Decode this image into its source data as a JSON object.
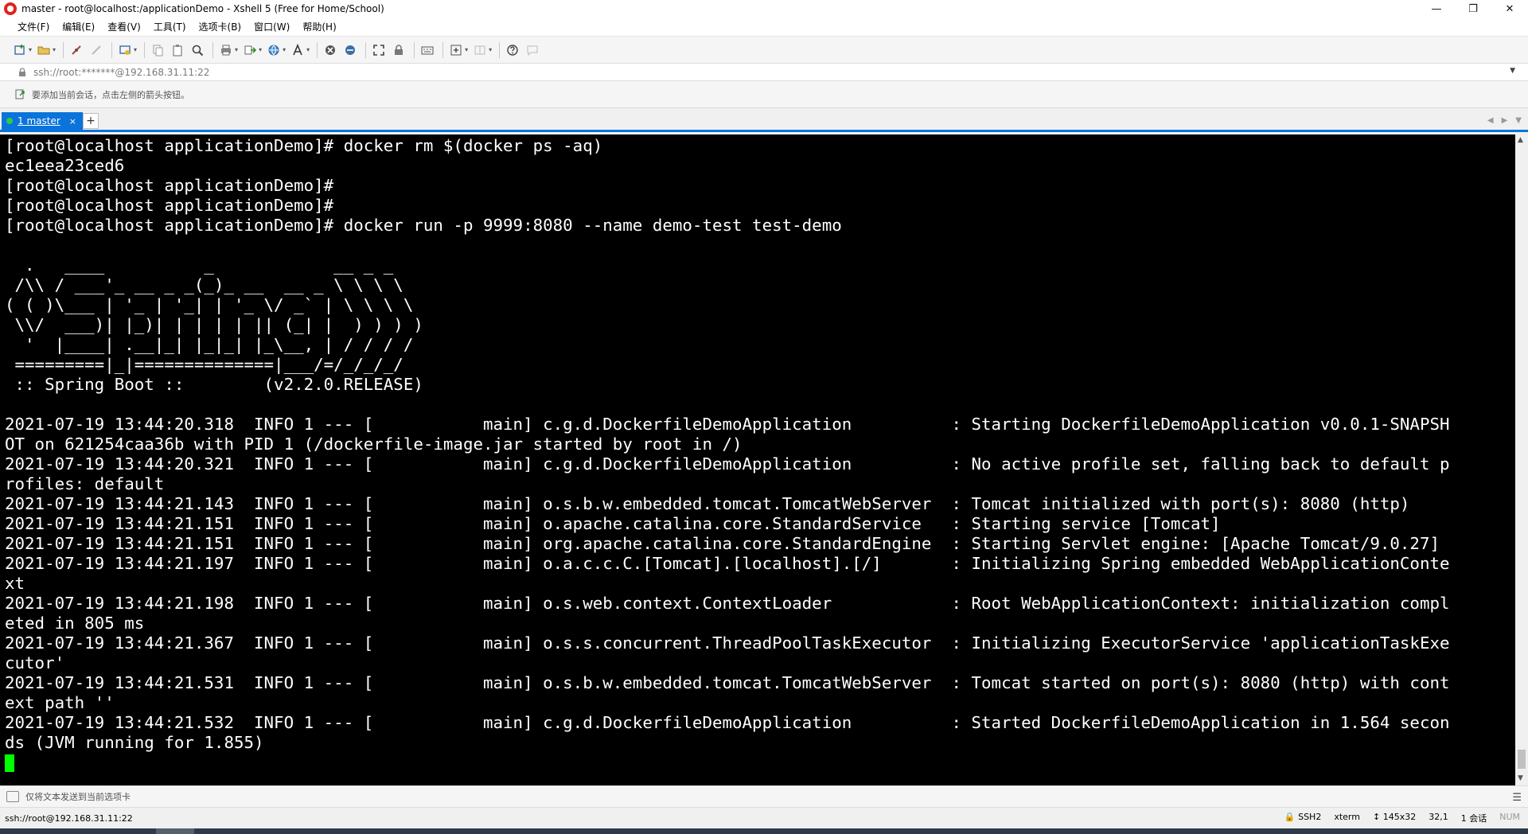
{
  "window": {
    "title": "master - root@localhost:/applicationDemo - Xshell 5 (Free for Home/School)",
    "controls": {
      "minimize": "—",
      "maximize": "❐",
      "close": "✕"
    }
  },
  "menu": [
    "文件(F)",
    "编辑(E)",
    "查看(V)",
    "工具(T)",
    "选项卡(B)",
    "窗口(W)",
    "帮助(H)"
  ],
  "address": {
    "value": "ssh://root:*******@192.168.31.11:22",
    "dropdown": "▼"
  },
  "hint": {
    "text": "要添加当前会话，点击左侧的箭头按钮。"
  },
  "tab": {
    "label": "1 master",
    "close": "×",
    "add": "+",
    "nav_prev": "◀",
    "nav_next": "▶",
    "nav_down": "▼"
  },
  "terminal": {
    "lines": [
      "[root@localhost applicationDemo]# docker rm $(docker ps -aq)",
      "ec1eea23ced6",
      "[root@localhost applicationDemo]#",
      "[root@localhost applicationDemo]#",
      "[root@localhost applicationDemo]# docker run -p 9999:8080 --name demo-test test-demo",
      "",
      "  .   ____          _            __ _ _",
      " /\\\\ / ___'_ __ _ _(_)_ __  __ _ \\ \\ \\ \\",
      "( ( )\\___ | '_ | '_| | '_ \\/ _` | \\ \\ \\ \\",
      " \\\\/  ___)| |_)| | | | | || (_| |  ) ) ) )",
      "  '  |____| .__|_| |_|_| |_\\__, | / / / /",
      " =========|_|==============|___/=/_/_/_/",
      " :: Spring Boot ::        (v2.2.0.RELEASE)",
      "",
      "2021-07-19 13:44:20.318  INFO 1 --- [           main] c.g.d.DockerfileDemoApplication          : Starting DockerfileDemoApplication v0.0.1-SNAPSH",
      "OT on 621254caa36b with PID 1 (/dockerfile-image.jar started by root in /)",
      "2021-07-19 13:44:20.321  INFO 1 --- [           main] c.g.d.DockerfileDemoApplication          : No active profile set, falling back to default p",
      "rofiles: default",
      "2021-07-19 13:44:21.143  INFO 1 --- [           main] o.s.b.w.embedded.tomcat.TomcatWebServer  : Tomcat initialized with port(s): 8080 (http)",
      "2021-07-19 13:44:21.151  INFO 1 --- [           main] o.apache.catalina.core.StandardService   : Starting service [Tomcat]",
      "2021-07-19 13:44:21.151  INFO 1 --- [           main] org.apache.catalina.core.StandardEngine  : Starting Servlet engine: [Apache Tomcat/9.0.27]",
      "2021-07-19 13:44:21.197  INFO 1 --- [           main] o.a.c.c.C.[Tomcat].[localhost].[/]       : Initializing Spring embedded WebApplicationConte",
      "xt",
      "2021-07-19 13:44:21.198  INFO 1 --- [           main] o.s.web.context.ContextLoader            : Root WebApplicationContext: initialization compl",
      "eted in 805 ms",
      "2021-07-19 13:44:21.367  INFO 1 --- [           main] o.s.s.concurrent.ThreadPoolTaskExecutor  : Initializing ExecutorService 'applicationTaskExe",
      "cutor'",
      "2021-07-19 13:44:21.531  INFO 1 --- [           main] o.s.b.w.embedded.tomcat.TomcatWebServer  : Tomcat started on port(s): 8080 (http) with cont",
      "ext path ''",
      "2021-07-19 13:44:21.532  INFO 1 --- [           main] c.g.d.DockerfileDemoApplication          : Started DockerfileDemoApplication in 1.564 secon",
      "ds (JVM running for 1.855)"
    ],
    "background": "#000000",
    "foreground": "#ffffff",
    "cursor_color": "#00ff00"
  },
  "compose": {
    "text": "仅将文本发送到当前选项卡",
    "menu": "☰"
  },
  "status": {
    "connection": "ssh://root@192.168.31.11:22",
    "protocol": "SSH2",
    "term": "xterm",
    "size": "145x32",
    "position": "32,1",
    "sessions": "1 会话",
    "num": "NUM"
  },
  "colors": {
    "accent": "#0a74da",
    "status_dot": "#2ecc40"
  }
}
